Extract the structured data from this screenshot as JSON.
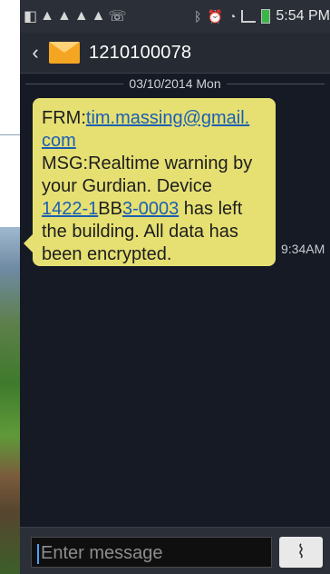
{
  "status_bar": {
    "left_icons": [
      "notification-icon",
      "warning-icon",
      "warning-icon",
      "warning-icon",
      "warning-icon",
      "missed-call-icon"
    ],
    "right_icons": [
      "bluetooth-icon",
      "alarm-icon",
      "nfc-icon",
      "signal-icon",
      "battery-icon"
    ],
    "time": "5:54 PM"
  },
  "title_bar": {
    "back_icon": "back-chevron-icon",
    "contact": "1210100078",
    "contact_icon": "envelope-icon"
  },
  "conversation": {
    "date": "03/10/2014 Mon",
    "message": {
      "frm_label": "FRM:",
      "email_part1": "tim.massing@gmail.",
      "email_part2": "com",
      "line_msg": "MSG:Realtime warning by",
      "line_2": "your Gurdian. Device",
      "device_link_1": "1422-1",
      "device_mid": "BB",
      "device_link_2": "3-0003",
      "device_after": " has left",
      "line_4": "the building. All data has",
      "line_5": "been encrypted.",
      "time": "9:34AM"
    }
  },
  "composer": {
    "placeholder": "Enter message",
    "attach_icon": "paperclip-icon"
  },
  "colors": {
    "bubble": "#e6e073",
    "link": "#1a5fb4",
    "background": "#151a24",
    "envelope": "#f4a623"
  }
}
